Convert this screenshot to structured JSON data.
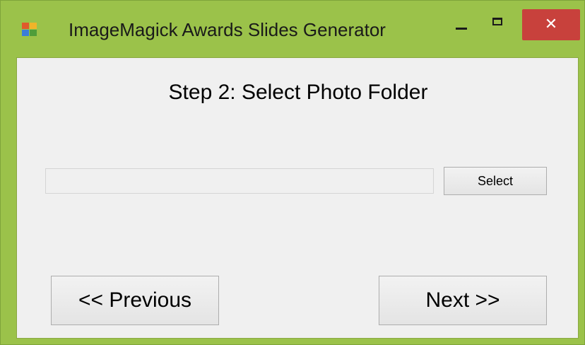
{
  "window": {
    "title": "ImageMagick Awards Slides Generator",
    "app_icon": "windows-forms-app-icon",
    "frame_color": "#9bc24a",
    "close_color": "#c8413c",
    "controls": {
      "minimize_icon": "minimize-icon",
      "maximize_icon": "maximize-icon",
      "close_glyph": "✕"
    }
  },
  "step": {
    "title": "Step 2:  Select Photo Folder"
  },
  "folder": {
    "value": "",
    "select_label": "Select"
  },
  "nav": {
    "previous_label": "<< Previous",
    "next_label": "Next >>"
  }
}
